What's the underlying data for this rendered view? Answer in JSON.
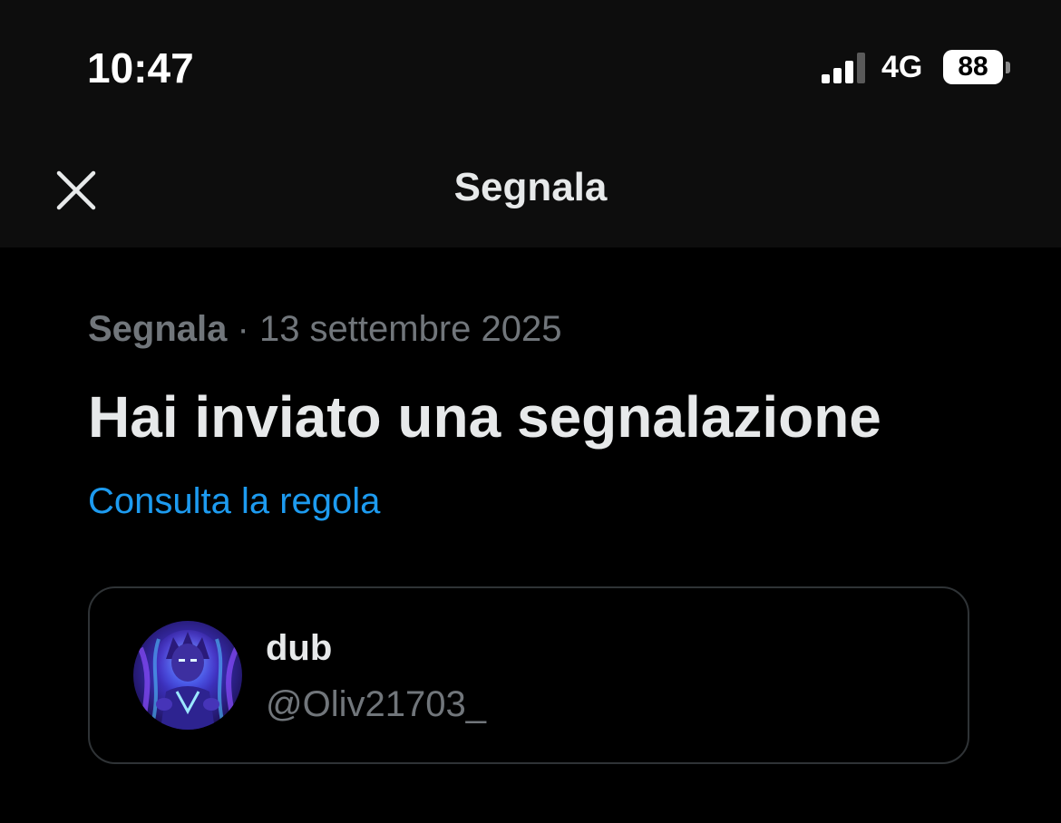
{
  "status_bar": {
    "time": "10:47",
    "network": "4G",
    "battery": "88",
    "icons": [
      "signal-icon",
      "battery-icon"
    ]
  },
  "nav": {
    "title": "Segnala",
    "close_icon": "close-icon"
  },
  "report": {
    "category": "Segnala",
    "separator": " · ",
    "date": "13 settembre 2025",
    "headline": "Hai inviato una segnalazione",
    "policy_link": "Consulta la regola"
  },
  "account": {
    "display_name": "dub",
    "handle": "@Oliv21703_",
    "avatar_icon": "avatar-image"
  },
  "colors": {
    "background": "#000000",
    "header_background": "#0d0d0d",
    "primary_text": "#e7e9ea",
    "secondary_text": "#71767b",
    "link": "#1d9bf0",
    "card_border": "#2f3336"
  }
}
